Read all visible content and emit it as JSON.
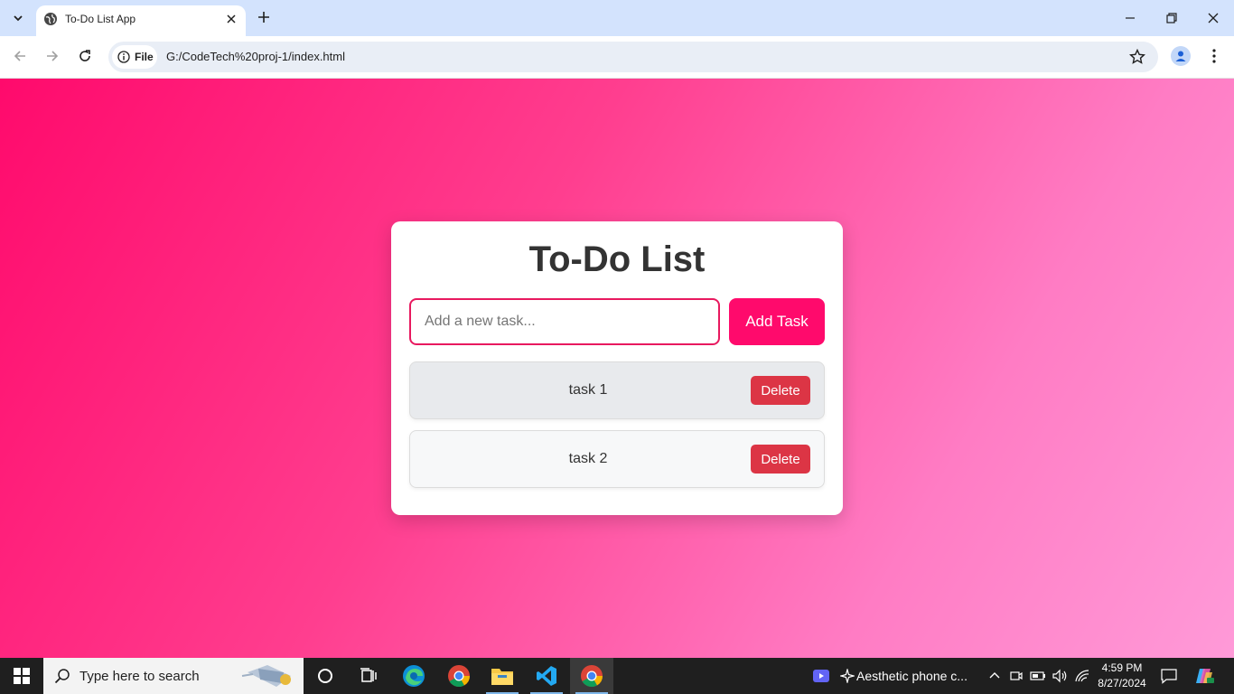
{
  "browser": {
    "tab_title": "To-Do List App",
    "site_chip_label": "File",
    "url": "G:/CodeTech%20proj-1/index.html"
  },
  "app": {
    "title": "To-Do List",
    "input_placeholder": "Add a new task...",
    "input_value": "",
    "add_button_label": "Add Task",
    "tasks": [
      {
        "text": "task 1",
        "delete_label": "Delete"
      },
      {
        "text": "task 2",
        "delete_label": "Delete"
      }
    ],
    "colors": {
      "accent": "#ff0a6c",
      "delete": "#dc3545",
      "gradient_start": "#ff0a6c",
      "gradient_end": "#ff9ad8"
    }
  },
  "taskbar": {
    "search_placeholder": "Type here to search",
    "media_title": "Aesthetic phone c...",
    "time": "4:59 PM",
    "date": "8/27/2024",
    "apps": [
      "edge-icon",
      "chrome-icon",
      "file-explorer-icon",
      "vscode-icon",
      "chrome-icon"
    ]
  }
}
